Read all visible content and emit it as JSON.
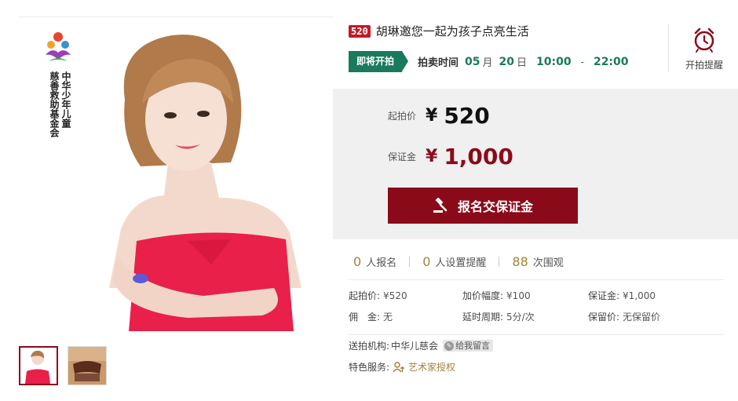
{
  "logo": {
    "org_text_cols": [
      "中华少年儿童",
      "慈善救助基金会"
    ]
  },
  "auction": {
    "badge": "520",
    "title": "胡琳邀您一起为孩子点亮生活",
    "status_tag": "即将开拍",
    "time_label": "拍卖时间",
    "month": "05",
    "month_unit": "月",
    "day": "20",
    "day_unit": "日",
    "start_time": "10:00",
    "dash": "-",
    "end_time": "22:00",
    "remind_label": "开拍提醒"
  },
  "price": {
    "start_label": "起拍价",
    "start_yen": "¥",
    "start_value": "520",
    "deposit_label": "保证金",
    "deposit_yen": "¥",
    "deposit_value": "1,000",
    "button_label": "报名交保证金"
  },
  "stats": {
    "signups_num": "0",
    "signups_label": "人报名",
    "reminders_num": "0",
    "reminders_label": "人设置提醒",
    "views_num": "88",
    "views_label": "次围观"
  },
  "info": {
    "start_price_k": "起拍价:",
    "start_price_v": "¥520",
    "increment_k": "加价幅度:",
    "increment_v": "¥100",
    "deposit_k": "保证金:",
    "deposit_v": "¥1,000",
    "commission_k": "佣　金:",
    "commission_v": "无",
    "delay_k": "延时周期:",
    "delay_v": "5分/次",
    "reserve_k": "保留价:",
    "reserve_v": "无保留价"
  },
  "org": {
    "label": "送拍机构:",
    "name": "中华儿慈会",
    "message_btn": "给我留言"
  },
  "service": {
    "label": "特色服务:",
    "link": "艺术家授权"
  },
  "colors": {
    "brand_red": "#8b0a1a",
    "badge_red": "#c11a26",
    "status_green": "#1a7a5e",
    "gold": "#a0843a",
    "price_panel": "#f0f0f0"
  }
}
